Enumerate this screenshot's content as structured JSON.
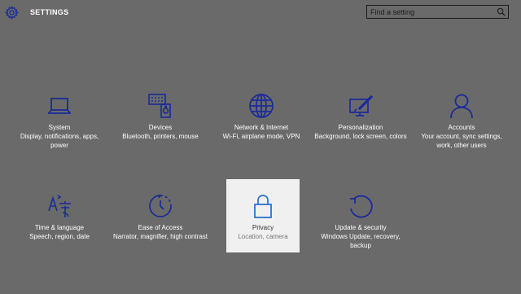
{
  "header": {
    "app_title": "SETTINGS",
    "search_placeholder": "Find a setting"
  },
  "colors": {
    "background": "#6a6a6a",
    "selected_tile": "#f0f0f0",
    "icon": "#1a2a9a",
    "selected_icon": "#2a72d0"
  },
  "tiles": [
    {
      "label": "System",
      "desc": "Display, notifications, apps, power",
      "icon": "laptop-icon"
    },
    {
      "label": "Devices",
      "desc": "Bluetooth, printers, mouse",
      "icon": "devices-icon"
    },
    {
      "label": "Network & Internet",
      "desc": "Wi-Fi, airplane mode, VPN",
      "icon": "globe-icon"
    },
    {
      "label": "Personalization",
      "desc": "Background, lock screen, colors",
      "icon": "personalization-icon"
    },
    {
      "label": "Accounts",
      "desc": "Your account, sync settings, work, other users",
      "icon": "person-icon"
    },
    {
      "label": "Time & language",
      "desc": "Speech, region, date",
      "icon": "time-language-icon"
    },
    {
      "label": "Ease of Access",
      "desc": "Narrator, magnifier, high contrast",
      "icon": "ease-of-access-icon"
    },
    {
      "label": "Privacy",
      "desc": "Location, camera",
      "icon": "lock-icon",
      "selected": true
    },
    {
      "label": "Update & security",
      "desc": "Windows Update, recovery, backup",
      "icon": "update-icon"
    }
  ]
}
